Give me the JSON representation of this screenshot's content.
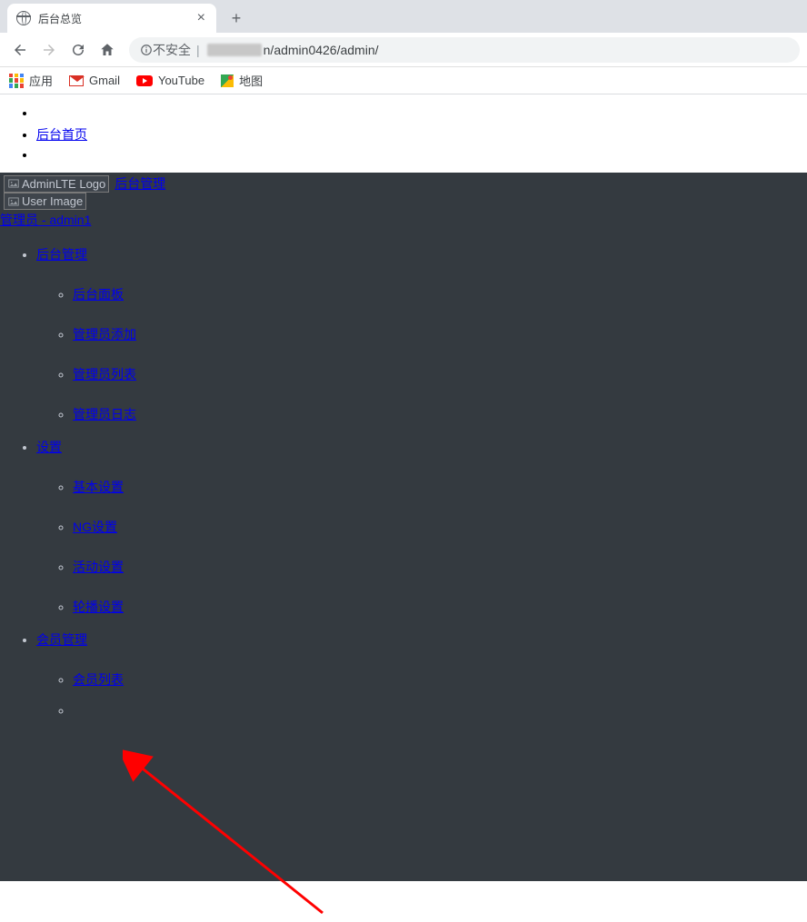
{
  "browser": {
    "tab_title": "后台总览",
    "address": {
      "security_label": "不安全",
      "url_suffix": "n/admin0426/admin/"
    },
    "bookmarks": {
      "apps": "应用",
      "gmail": "Gmail",
      "youtube": "YouTube",
      "maps": "地图"
    }
  },
  "top_nav": {
    "home": "后台首页"
  },
  "sidebar": {
    "logo_alt": "AdminLTE Logo",
    "brand": "后台管理",
    "user_alt": "User Image",
    "user_label": "管理员 - admin1",
    "menu": [
      {
        "label": "后台管理",
        "items": [
          "后台面板",
          "管理员添加",
          "管理员列表",
          "管理员日志"
        ]
      },
      {
        "label": "设置",
        "items": [
          "基本设置",
          "NG设置",
          "活动设置",
          "轮播设置"
        ]
      },
      {
        "label": "会员管理",
        "items": [
          "会员列表"
        ]
      }
    ]
  }
}
